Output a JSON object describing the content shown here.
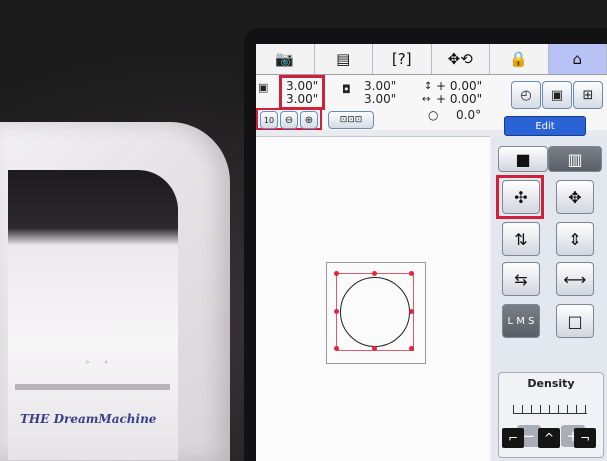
{
  "machine": {
    "brand_text": "THE DreamMachine"
  },
  "tabs": [
    {
      "label": "📷"
    },
    {
      "label": "▤"
    },
    {
      "label": "[?]"
    },
    {
      "label": "✥⟲"
    },
    {
      "label": "🔒"
    },
    {
      "label": "⌂"
    }
  ],
  "info": {
    "size_w": "3.00\"",
    "size_h": "3.00\"",
    "pattern_w": "3.00\"",
    "pattern_h": "3.00\"",
    "offset_v": "+ 0.00\"",
    "offset_h": "+ 0.00\"",
    "angle": "0.0°",
    "edit_label": "Edit"
  },
  "panel": {
    "lms_label": "L M S",
    "density_label": "Density",
    "minus": "−",
    "plus": "+"
  },
  "nav": {
    "left": "⌐",
    "up": "^",
    "right": "¬"
  }
}
